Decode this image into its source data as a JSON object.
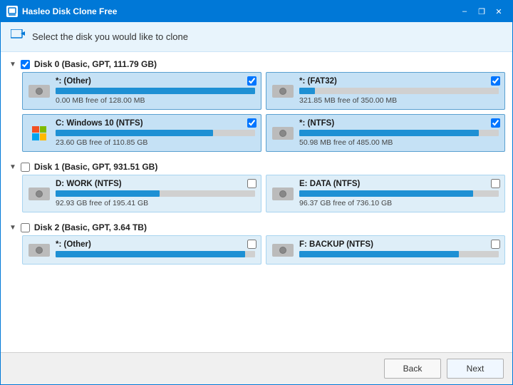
{
  "window": {
    "title": "Hasleo Disk Clone Free",
    "controls": {
      "minimize": "–",
      "restore": "❐",
      "close": "✕"
    }
  },
  "header": {
    "icon": "→",
    "text": "Select the disk you would like to clone"
  },
  "disks": [
    {
      "id": "disk0",
      "label": "Disk 0 (Basic, GPT, 111.79 GB)",
      "checked": true,
      "expanded": true,
      "partitions": [
        {
          "name": "*: (Other)",
          "size_text": "0.00 MB free of 128.00 MB",
          "fill_pct": 100,
          "checked": true,
          "icon_type": "hdd"
        },
        {
          "name": "*: (FAT32)",
          "size_text": "321.85 MB free of 350.00 MB",
          "fill_pct": 8,
          "checked": true,
          "icon_type": "hdd"
        },
        {
          "name": "C: Windows 10 (NTFS)",
          "size_text": "23.60 GB free of 110.85 GB",
          "fill_pct": 79,
          "checked": true,
          "icon_type": "windows"
        },
        {
          "name": "*: (NTFS)",
          "size_text": "50.98 MB free of 485.00 MB",
          "fill_pct": 90,
          "checked": true,
          "icon_type": "hdd"
        }
      ]
    },
    {
      "id": "disk1",
      "label": "Disk 1 (Basic, GPT, 931.51 GB)",
      "checked": false,
      "expanded": true,
      "partitions": [
        {
          "name": "D: WORK (NTFS)",
          "size_text": "92.93 GB free of 195.41 GB",
          "fill_pct": 52,
          "checked": false,
          "icon_type": "hdd"
        },
        {
          "name": "E: DATA (NTFS)",
          "size_text": "96.37 GB free of 736.10 GB",
          "fill_pct": 87,
          "checked": false,
          "icon_type": "hdd"
        }
      ]
    },
    {
      "id": "disk2",
      "label": "Disk 2 (Basic, GPT, 3.64 TB)",
      "checked": false,
      "expanded": true,
      "partitions": [
        {
          "name": "*: (Other)",
          "size_text": "",
          "fill_pct": 95,
          "checked": false,
          "icon_type": "hdd"
        },
        {
          "name": "F: BACKUP (NTFS)",
          "size_text": "",
          "fill_pct": 80,
          "checked": false,
          "icon_type": "hdd"
        }
      ]
    }
  ],
  "footer": {
    "back_label": "Back",
    "next_label": "Next"
  }
}
